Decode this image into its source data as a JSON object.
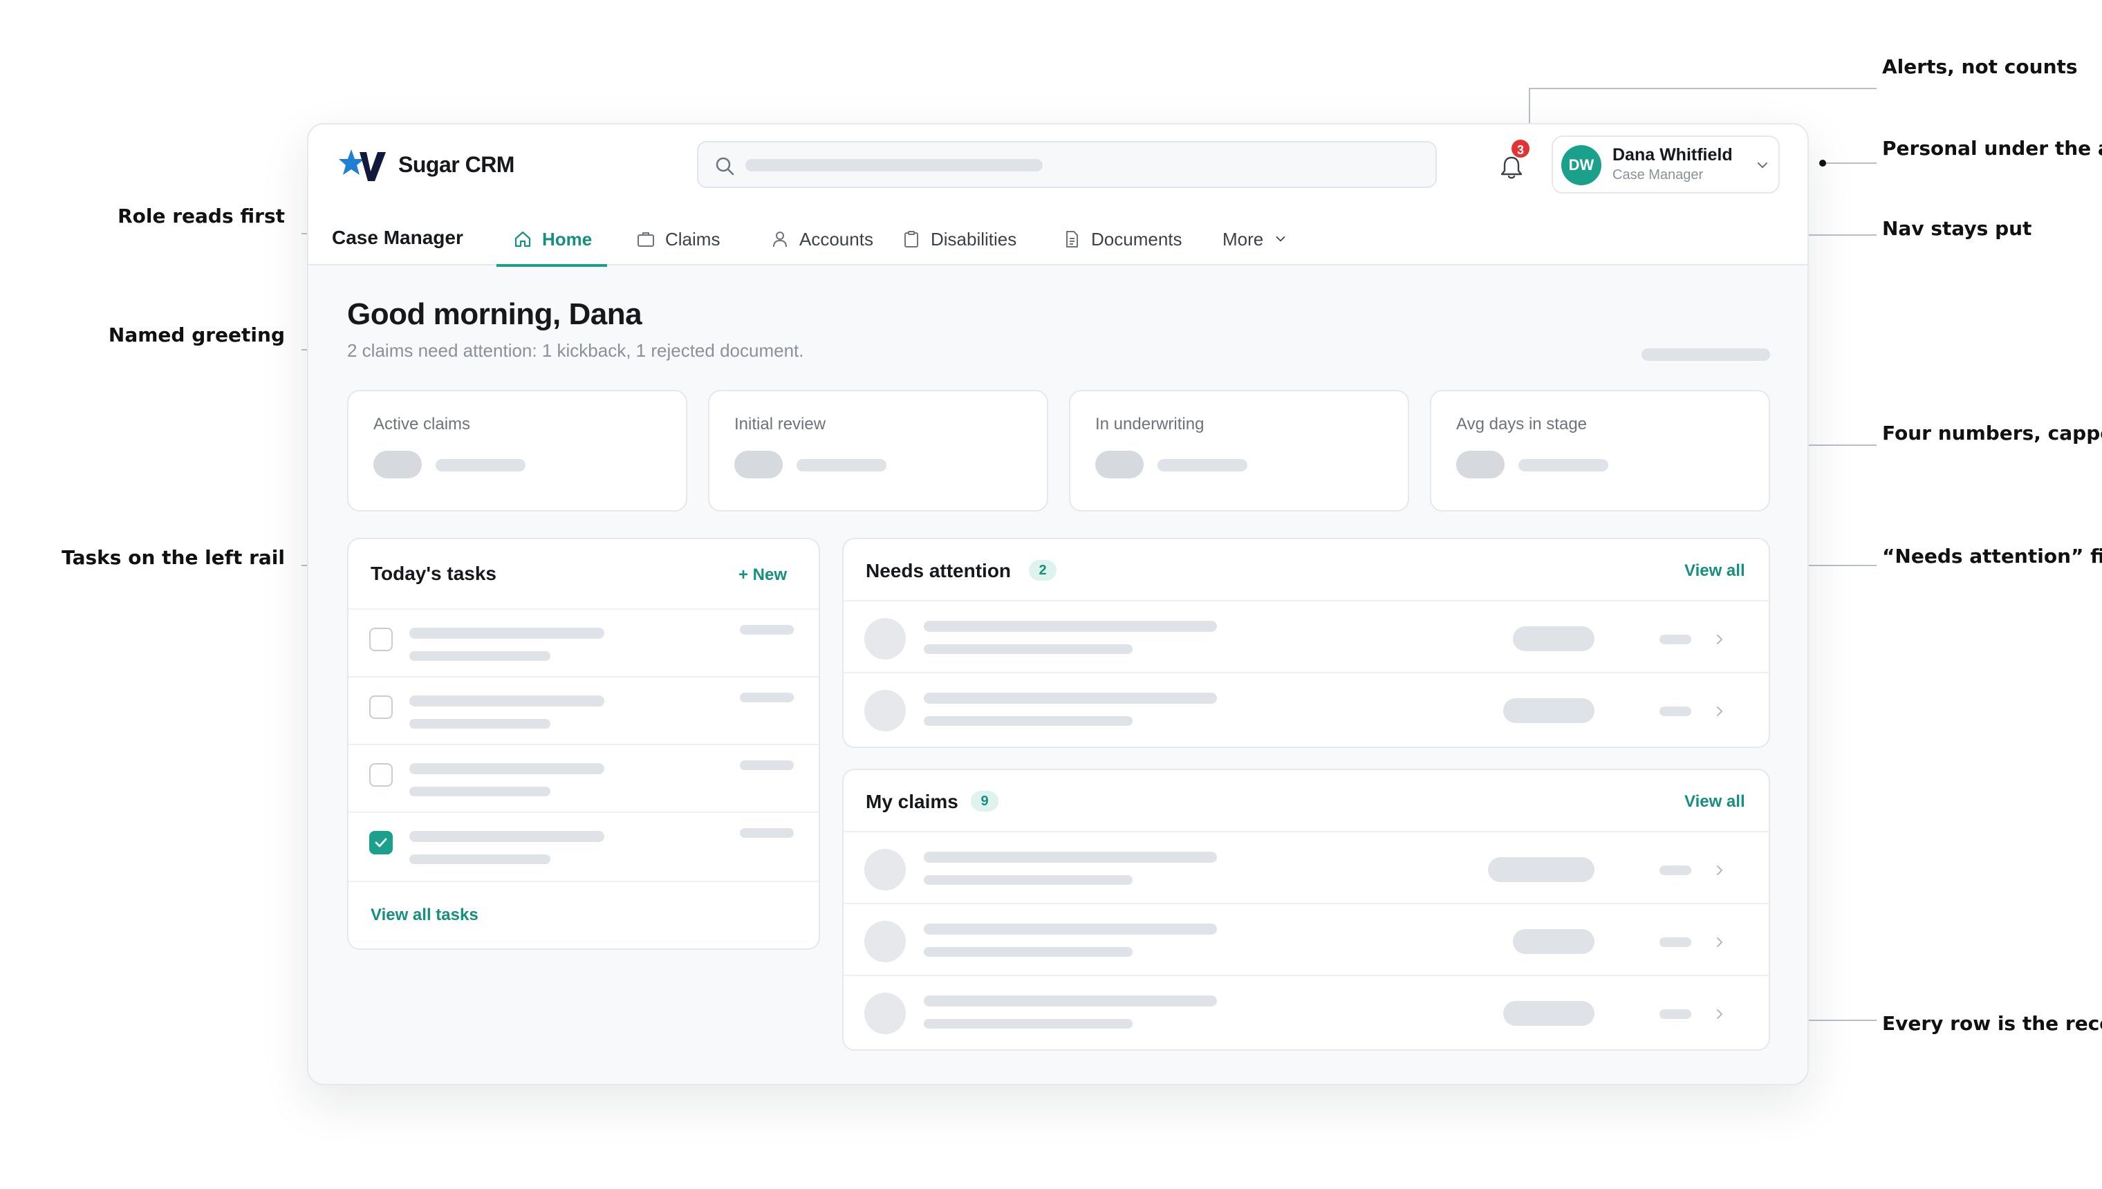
{
  "annotations": {
    "alerts": "Alerts, not counts",
    "personal": "Personal under the avatar",
    "role": "Role reads first",
    "nav": "Nav stays put",
    "greeting": "Named greeting",
    "numbers": "Four numbers, capped",
    "tasks": "Tasks on the left rail",
    "needs": "“Needs attention” first",
    "rows": "Every row is the record"
  },
  "brand": {
    "name": "Sugar CRM"
  },
  "notifications": {
    "count": "3"
  },
  "user": {
    "initials": "DW",
    "name": "Dana Whitfield",
    "role": "Case Manager"
  },
  "nav": {
    "role_label": "Case Manager",
    "items": [
      {
        "label": "Home",
        "icon": "home-icon"
      },
      {
        "label": "Claims",
        "icon": "briefcase-icon"
      },
      {
        "label": "Accounts",
        "icon": "person-icon"
      },
      {
        "label": "Disabilities",
        "icon": "clipboard-icon"
      },
      {
        "label": "Documents",
        "icon": "document-icon"
      },
      {
        "label": "More",
        "icon": "chevron-down-icon"
      }
    ]
  },
  "greeting": {
    "title": "Good morning, Dana",
    "subtitle": "2 claims need attention: 1 kickback, 1 rejected document."
  },
  "stats": [
    {
      "label": "Active claims"
    },
    {
      "label": "Initial review"
    },
    {
      "label": "In underwriting"
    },
    {
      "label": "Avg days in stage"
    }
  ],
  "tasks": {
    "title": "Today's tasks",
    "new_label": "+ New",
    "view_all": "View all tasks"
  },
  "needs_attention": {
    "title": "Needs attention",
    "count": "2",
    "view_all": "View all"
  },
  "my_claims": {
    "title": "My claims",
    "count": "9",
    "view_all": "View all"
  },
  "colors": {
    "accent": "#1aa08b",
    "alert": "#e03434"
  }
}
